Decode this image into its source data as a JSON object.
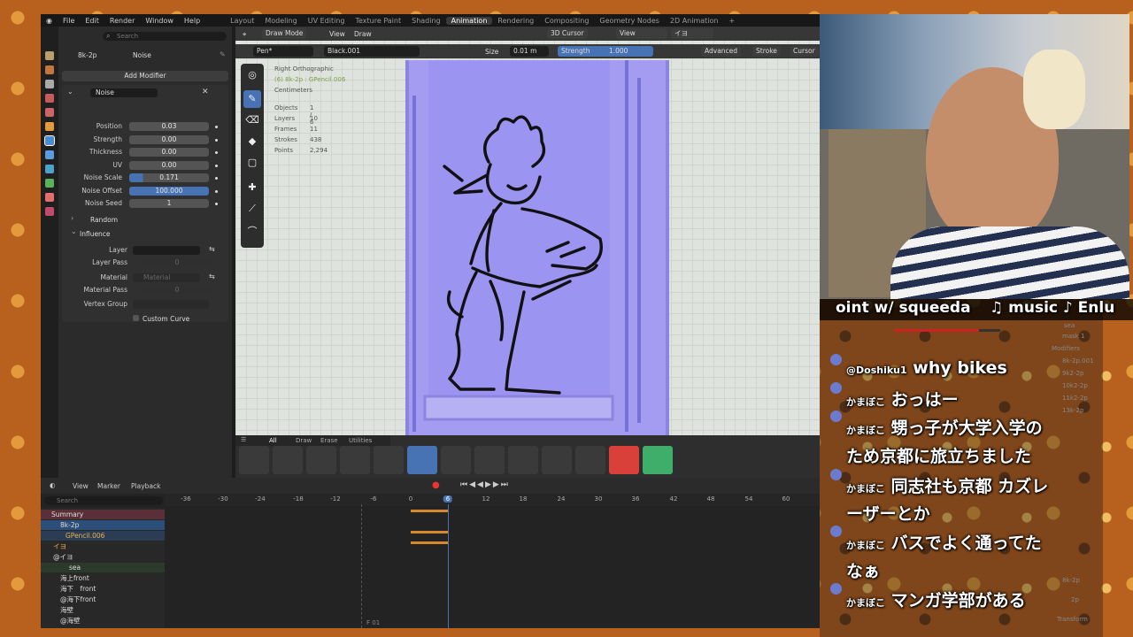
{
  "menu": {
    "items": [
      "File",
      "Edit",
      "Render",
      "Window",
      "Help"
    ],
    "workspaces": [
      "Layout",
      "Modeling",
      "UV Editing",
      "Texture Paint",
      "Shading",
      "Animation",
      "Rendering",
      "Compositing",
      "Geometry Nodes",
      "2D Animation",
      "+"
    ],
    "active_workspace": "Animation"
  },
  "props": {
    "object_name": "8k-2p",
    "modifier_breadcrumb": "Noise",
    "search_placeholder": "Search",
    "add_modifier": "Add Modifier",
    "modifier_name": "Noise",
    "fields": [
      {
        "label": "Position",
        "value": "0.03"
      },
      {
        "label": "Strength",
        "value": "0.00"
      },
      {
        "label": "Thickness",
        "value": "0.00"
      },
      {
        "label": "UV",
        "value": "0.00"
      },
      {
        "label": "Noise Scale",
        "value": "0.171"
      },
      {
        "label": "Noise Offset",
        "value": "100.000"
      },
      {
        "label": "Noise Seed",
        "value": "1"
      }
    ],
    "random": "Random",
    "influence": "Influence",
    "layer_label": "Layer",
    "layer_pass_label": "Layer Pass",
    "layer_pass_value": "0",
    "material_label": "Material",
    "material_placeholder": "Material",
    "material_pass_label": "Material Pass",
    "material_pass_value": "0",
    "vertex_group_label": "Vertex Group",
    "custom_curve": "Custom Curve"
  },
  "viewport": {
    "mode": "Draw Mode",
    "view": "View",
    "draw": "Draw",
    "cursor_3d": "3D Cursor",
    "view2": "View",
    "overlay_label": "イヨ",
    "brush": "Pen*",
    "material": "Black.001",
    "size_label": "Size",
    "size_value": "0.01 m",
    "strength_label": "Strength",
    "strength_value": "1.000",
    "advanced": "Advanced",
    "stroke": "Stroke",
    "cursor": "Cursor",
    "info": [
      "Right Orthographic",
      "(6) 8k-2p : GPencil.006",
      "Centimeters"
    ],
    "stats": [
      [
        "Objects",
        "1 / 6"
      ],
      [
        "Layers",
        "10"
      ],
      [
        "Frames",
        "11"
      ],
      [
        "Strokes",
        "438"
      ],
      [
        "Points",
        "2,294"
      ]
    ]
  },
  "brushbar": {
    "tabs": [
      "All",
      "Draw",
      "Erase",
      "Utilities"
    ],
    "active_tab": "All"
  },
  "timeline": {
    "view": "View",
    "marker": "Marker",
    "playback": "Playback",
    "search_placeholder": "Search",
    "ruler": [
      "-36",
      "-30",
      "-24",
      "-18",
      "-12",
      "-6",
      "0",
      "6",
      "12",
      "18",
      "24",
      "30",
      "36",
      "42",
      "48",
      "54",
      "60",
      "6"
    ],
    "current_frame": "6",
    "channels": [
      "Summary",
      "8k-2p",
      "GPencil.006",
      "イヨ",
      "@イヨ",
      "sea",
      "海上front",
      "海下　front",
      "@海下front",
      "海壁",
      "@海壁"
    ],
    "bottom_label": "F 01"
  },
  "stream": {
    "ticker_left": "oint w/ squeeda",
    "ticker_right": "♫ music ♪ Enlu",
    "chat": [
      {
        "user": "@Doshiku1",
        "text": "why bikes"
      },
      {
        "user": "かまぼこ",
        "text": "おっはー"
      },
      {
        "user": "かまぼこ",
        "text": "甥っ子が大学入学の"
      },
      {
        "user": "",
        "text": "ため京都に旅立ちました"
      },
      {
        "user": "かまぼこ",
        "text": "同志社も京都 カズレ"
      },
      {
        "user": "",
        "text": "ーザーとか"
      },
      {
        "user": "かまぼこ",
        "text": "バスでよく通ってた"
      },
      {
        "user": "",
        "text": "なぁ"
      },
      {
        "user": "かまぼこ",
        "text": "マンガ学部がある"
      }
    ],
    "outliner_fragments": [
      "sea",
      "mask 1",
      "Modifiers",
      "8k-2p.001",
      "9k2-2p",
      "10k2-2p",
      "11k2-2p",
      "13k-2p",
      "8k-2p",
      "2p",
      "Transform"
    ]
  }
}
